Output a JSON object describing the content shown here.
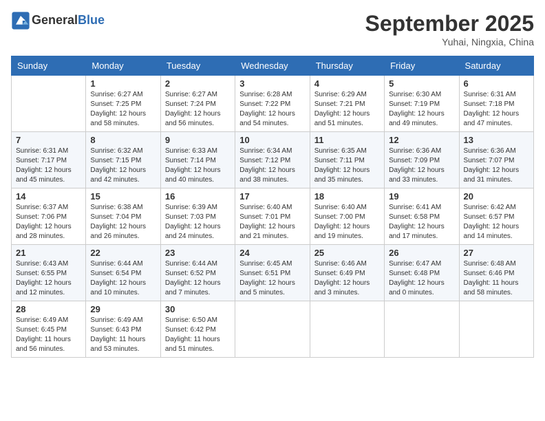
{
  "header": {
    "logo_general": "General",
    "logo_blue": "Blue",
    "month_title": "September 2025",
    "location": "Yuhai, Ningxia, China"
  },
  "days_of_week": [
    "Sunday",
    "Monday",
    "Tuesday",
    "Wednesday",
    "Thursday",
    "Friday",
    "Saturday"
  ],
  "weeks": [
    [
      {
        "day": "",
        "sunrise": "",
        "sunset": "",
        "daylight": ""
      },
      {
        "day": "1",
        "sunrise": "Sunrise: 6:27 AM",
        "sunset": "Sunset: 7:25 PM",
        "daylight": "Daylight: 12 hours and 58 minutes."
      },
      {
        "day": "2",
        "sunrise": "Sunrise: 6:27 AM",
        "sunset": "Sunset: 7:24 PM",
        "daylight": "Daylight: 12 hours and 56 minutes."
      },
      {
        "day": "3",
        "sunrise": "Sunrise: 6:28 AM",
        "sunset": "Sunset: 7:22 PM",
        "daylight": "Daylight: 12 hours and 54 minutes."
      },
      {
        "day": "4",
        "sunrise": "Sunrise: 6:29 AM",
        "sunset": "Sunset: 7:21 PM",
        "daylight": "Daylight: 12 hours and 51 minutes."
      },
      {
        "day": "5",
        "sunrise": "Sunrise: 6:30 AM",
        "sunset": "Sunset: 7:19 PM",
        "daylight": "Daylight: 12 hours and 49 minutes."
      },
      {
        "day": "6",
        "sunrise": "Sunrise: 6:31 AM",
        "sunset": "Sunset: 7:18 PM",
        "daylight": "Daylight: 12 hours and 47 minutes."
      }
    ],
    [
      {
        "day": "7",
        "sunrise": "Sunrise: 6:31 AM",
        "sunset": "Sunset: 7:17 PM",
        "daylight": "Daylight: 12 hours and 45 minutes."
      },
      {
        "day": "8",
        "sunrise": "Sunrise: 6:32 AM",
        "sunset": "Sunset: 7:15 PM",
        "daylight": "Daylight: 12 hours and 42 minutes."
      },
      {
        "day": "9",
        "sunrise": "Sunrise: 6:33 AM",
        "sunset": "Sunset: 7:14 PM",
        "daylight": "Daylight: 12 hours and 40 minutes."
      },
      {
        "day": "10",
        "sunrise": "Sunrise: 6:34 AM",
        "sunset": "Sunset: 7:12 PM",
        "daylight": "Daylight: 12 hours and 38 minutes."
      },
      {
        "day": "11",
        "sunrise": "Sunrise: 6:35 AM",
        "sunset": "Sunset: 7:11 PM",
        "daylight": "Daylight: 12 hours and 35 minutes."
      },
      {
        "day": "12",
        "sunrise": "Sunrise: 6:36 AM",
        "sunset": "Sunset: 7:09 PM",
        "daylight": "Daylight: 12 hours and 33 minutes."
      },
      {
        "day": "13",
        "sunrise": "Sunrise: 6:36 AM",
        "sunset": "Sunset: 7:07 PM",
        "daylight": "Daylight: 12 hours and 31 minutes."
      }
    ],
    [
      {
        "day": "14",
        "sunrise": "Sunrise: 6:37 AM",
        "sunset": "Sunset: 7:06 PM",
        "daylight": "Daylight: 12 hours and 28 minutes."
      },
      {
        "day": "15",
        "sunrise": "Sunrise: 6:38 AM",
        "sunset": "Sunset: 7:04 PM",
        "daylight": "Daylight: 12 hours and 26 minutes."
      },
      {
        "day": "16",
        "sunrise": "Sunrise: 6:39 AM",
        "sunset": "Sunset: 7:03 PM",
        "daylight": "Daylight: 12 hours and 24 minutes."
      },
      {
        "day": "17",
        "sunrise": "Sunrise: 6:40 AM",
        "sunset": "Sunset: 7:01 PM",
        "daylight": "Daylight: 12 hours and 21 minutes."
      },
      {
        "day": "18",
        "sunrise": "Sunrise: 6:40 AM",
        "sunset": "Sunset: 7:00 PM",
        "daylight": "Daylight: 12 hours and 19 minutes."
      },
      {
        "day": "19",
        "sunrise": "Sunrise: 6:41 AM",
        "sunset": "Sunset: 6:58 PM",
        "daylight": "Daylight: 12 hours and 17 minutes."
      },
      {
        "day": "20",
        "sunrise": "Sunrise: 6:42 AM",
        "sunset": "Sunset: 6:57 PM",
        "daylight": "Daylight: 12 hours and 14 minutes."
      }
    ],
    [
      {
        "day": "21",
        "sunrise": "Sunrise: 6:43 AM",
        "sunset": "Sunset: 6:55 PM",
        "daylight": "Daylight: 12 hours and 12 minutes."
      },
      {
        "day": "22",
        "sunrise": "Sunrise: 6:44 AM",
        "sunset": "Sunset: 6:54 PM",
        "daylight": "Daylight: 12 hours and 10 minutes."
      },
      {
        "day": "23",
        "sunrise": "Sunrise: 6:44 AM",
        "sunset": "Sunset: 6:52 PM",
        "daylight": "Daylight: 12 hours and 7 minutes."
      },
      {
        "day": "24",
        "sunrise": "Sunrise: 6:45 AM",
        "sunset": "Sunset: 6:51 PM",
        "daylight": "Daylight: 12 hours and 5 minutes."
      },
      {
        "day": "25",
        "sunrise": "Sunrise: 6:46 AM",
        "sunset": "Sunset: 6:49 PM",
        "daylight": "Daylight: 12 hours and 3 minutes."
      },
      {
        "day": "26",
        "sunrise": "Sunrise: 6:47 AM",
        "sunset": "Sunset: 6:48 PM",
        "daylight": "Daylight: 12 hours and 0 minutes."
      },
      {
        "day": "27",
        "sunrise": "Sunrise: 6:48 AM",
        "sunset": "Sunset: 6:46 PM",
        "daylight": "Daylight: 11 hours and 58 minutes."
      }
    ],
    [
      {
        "day": "28",
        "sunrise": "Sunrise: 6:49 AM",
        "sunset": "Sunset: 6:45 PM",
        "daylight": "Daylight: 11 hours and 56 minutes."
      },
      {
        "day": "29",
        "sunrise": "Sunrise: 6:49 AM",
        "sunset": "Sunset: 6:43 PM",
        "daylight": "Daylight: 11 hours and 53 minutes."
      },
      {
        "day": "30",
        "sunrise": "Sunrise: 6:50 AM",
        "sunset": "Sunset: 6:42 PM",
        "daylight": "Daylight: 11 hours and 51 minutes."
      },
      {
        "day": "",
        "sunrise": "",
        "sunset": "",
        "daylight": ""
      },
      {
        "day": "",
        "sunrise": "",
        "sunset": "",
        "daylight": ""
      },
      {
        "day": "",
        "sunrise": "",
        "sunset": "",
        "daylight": ""
      },
      {
        "day": "",
        "sunrise": "",
        "sunset": "",
        "daylight": ""
      }
    ]
  ]
}
